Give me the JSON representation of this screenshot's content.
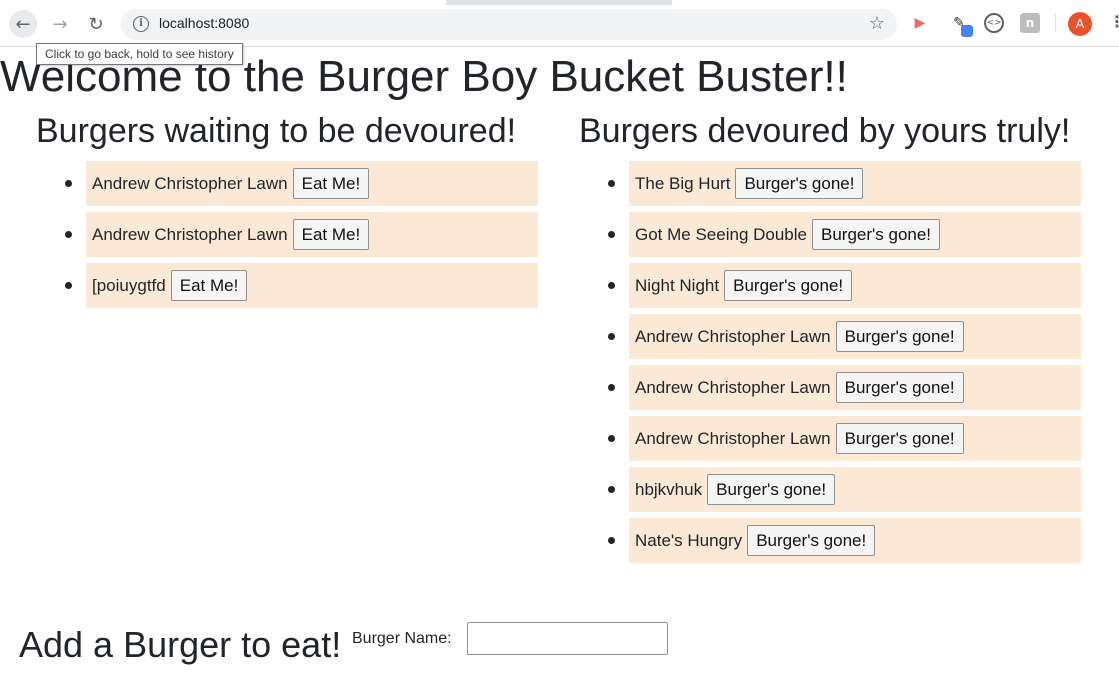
{
  "browser": {
    "url": "localhost:8080",
    "back_tooltip": "Click to go back, hold to see history",
    "profile_initial": "A",
    "icons": [
      "back-arrow-icon",
      "forward-arrow-icon",
      "reload-icon",
      "info-icon",
      "star-icon",
      "extension-icon",
      "eyedropper-icon",
      "extension-icon",
      "extension-icon",
      "menu-icon"
    ]
  },
  "page": {
    "title": "Welcome to the Burger Boy Bucket Buster!!",
    "waiting": {
      "heading": "Burgers waiting to be devoured!",
      "button_label": "Eat Me!",
      "items": [
        "Andrew Christopher Lawn",
        "Andrew Christopher Lawn",
        "[poiuygtfd"
      ]
    },
    "devoured": {
      "heading": "Burgers devoured by yours truly!",
      "button_label": "Burger's gone!",
      "items": [
        "The Big Hurt",
        "Got Me Seeing Double",
        "Night Night",
        "Andrew Christopher Lawn",
        "Andrew Christopher Lawn",
        "Andrew Christopher Lawn",
        "hbjkvhuk",
        "Nate's Hungry"
      ]
    },
    "add_form": {
      "heading": "Add a Burger to eat!",
      "label": "Burger Name:",
      "value": ""
    }
  },
  "colors": {
    "item_background": "#fbe9d6",
    "text": "#212529",
    "avatar": "#e8532b"
  }
}
